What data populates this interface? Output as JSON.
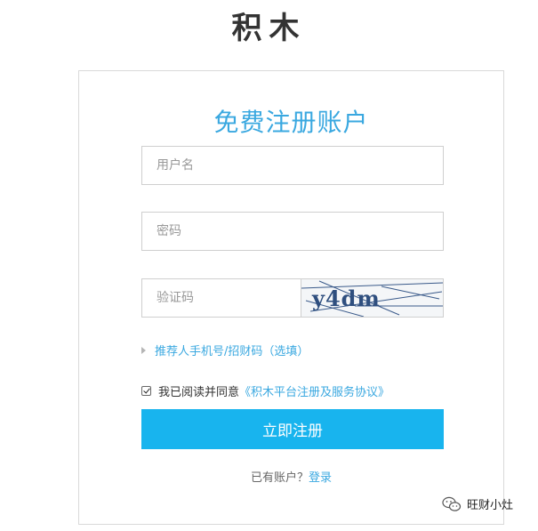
{
  "brand": {
    "name": "积木"
  },
  "form": {
    "title": "免费注册账户",
    "username": {
      "placeholder": "用户名",
      "value": ""
    },
    "password": {
      "placeholder": "密码",
      "value": ""
    },
    "captcha": {
      "placeholder": "验证码",
      "value": "",
      "image_text": "y4dm"
    },
    "referrer_label": "推荐人手机号/招财码（选填）",
    "agreement": {
      "checked": true,
      "prefix": "我已阅读并同意",
      "link": "《积木平台注册及服务协议》"
    },
    "submit_label": "立即注册",
    "login_prompt": "已有账户？",
    "login_link": "登录"
  },
  "watermark": {
    "text": "旺财小灶"
  },
  "colors": {
    "accent": "#3aa8e0",
    "button": "#18b4ee",
    "border": "#cfcfcf",
    "brand_text": "#333333"
  },
  "icons": {
    "referrer": "triangle-right-icon",
    "watermark": "wechat-icon",
    "agreement": "checkbox-checked-icon"
  }
}
